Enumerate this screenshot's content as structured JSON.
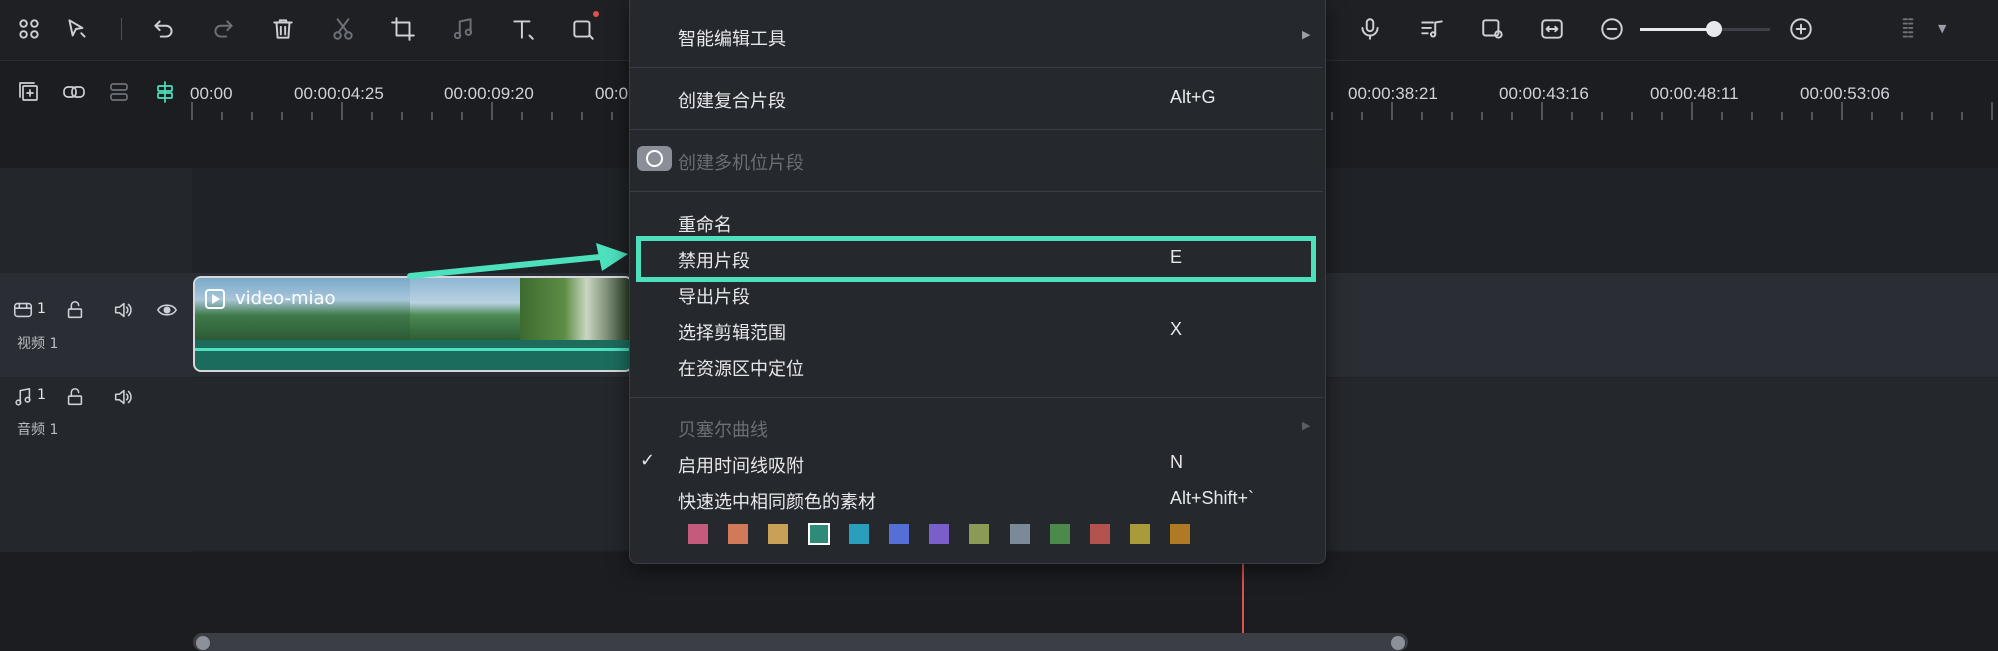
{
  "toolbar": {
    "icons": [
      "layout-icon",
      "select-tool-icon",
      "undo-icon",
      "redo-icon",
      "delete-icon",
      "cut-icon",
      "crop-icon",
      "audio-edit-icon",
      "text-icon",
      "shape-icon",
      "mic-icon",
      "music-list-icon",
      "preview-icon",
      "fit-icon",
      "zoom-out-icon",
      "zoom-in-icon",
      "grid-icon"
    ]
  },
  "zoom": {
    "level": 0.57
  },
  "ruler": {
    "ticks": [
      "00:00",
      "00:00:04:25",
      "00:00:09:20",
      "00:0",
      "00:00:38:21",
      "00:00:43:16",
      "00:00:48:11",
      "00:00:53:06"
    ]
  },
  "tracks": {
    "video": {
      "number": "1",
      "label": "视频 1"
    },
    "audio": {
      "number": "1",
      "label": "音频 1"
    }
  },
  "clip": {
    "title": "video-miao"
  },
  "menu": {
    "smart_tools": "智能编辑工具",
    "compound": "创建复合片段",
    "compound_key": "Alt+G",
    "multicam": "创建多机位片段",
    "rename": "重命名",
    "disable": "禁用片段",
    "disable_key": "E",
    "export": "导出片段",
    "select_range": "选择剪辑范围",
    "select_range_key": "X",
    "locate": "在资源区中定位",
    "bezier": "贝塞尔曲线",
    "snap": "启用时间线吸附",
    "snap_key": "N",
    "same_color": "快速选中相同颜色的素材",
    "same_color_key": "Alt+Shift+`"
  },
  "colors": {
    "accent": "#4de0bd",
    "swatches": [
      "#c45b7c",
      "#d07a5a",
      "#c9a057",
      "#2f8a7a",
      "#2a9fbd",
      "#5470d6",
      "#7a5ec9",
      "#8c9a57",
      "#7a8a99",
      "#4c8a4c",
      "#b3534f",
      "#a99a3a",
      "#b07a24"
    ]
  }
}
